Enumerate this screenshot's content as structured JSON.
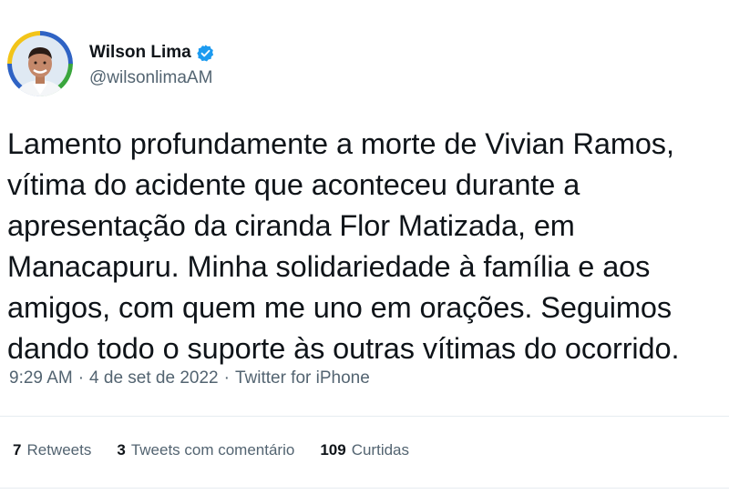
{
  "author": {
    "display_name": "Wilson Lima",
    "handle": "@wilsonlimaAM",
    "verified": true,
    "avatar_icon": "profile-photo-avatar"
  },
  "tweet": {
    "text": "Lamento profundamente a morte de Vivian Ramos,\nvítima do acidente que aconteceu durante a\napresentação da ciranda Flor Matizada, em\nManacapuru. Minha solidariedade à família e aos\namigos, com quem me uno em orações. Seguimos\ndando todo o suporte às outras vítimas do ocorrido.",
    "time": "9:29 AM",
    "date": "4 de set de 2022",
    "source": "Twitter for iPhone",
    "separator": "·"
  },
  "stats": {
    "retweets_count": "7",
    "retweets_label": "Retweets",
    "quotes_count": "3",
    "quotes_label": "Tweets com comentário",
    "likes_count": "109",
    "likes_label": "Curtidas"
  },
  "colors": {
    "text_primary": "#0f1419",
    "text_secondary": "#536471",
    "verified_blue": "#1d9bf0",
    "divider": "#e6ecf0"
  }
}
